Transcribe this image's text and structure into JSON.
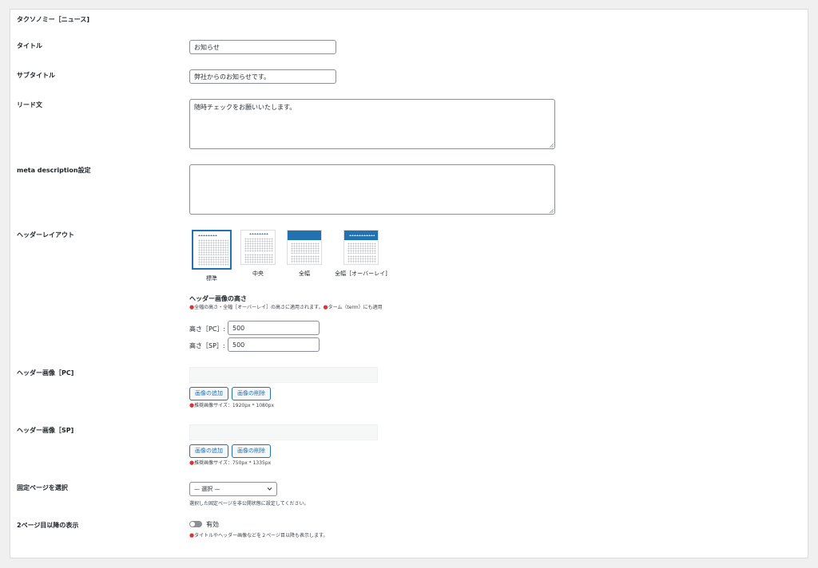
{
  "section_title": "タクソノミー［ニュース]",
  "fields": {
    "title": {
      "label": "タイトル",
      "value": "お知らせ"
    },
    "subtitle": {
      "label": "サブタイトル",
      "value": "弊社からのお知らせです。"
    },
    "lead": {
      "label": "リード文",
      "value": "随時チェックをお願いいたします。"
    },
    "meta": {
      "label": "meta description設定",
      "value": ""
    }
  },
  "header_layout": {
    "label": "ヘッダーレイアウト",
    "options": [
      {
        "caption": "標準",
        "selected": true
      },
      {
        "caption": "中央",
        "selected": false
      },
      {
        "caption": "全幅",
        "selected": false
      },
      {
        "caption": "全幅［オーバーレイ]",
        "selected": false
      }
    ]
  },
  "header_height": {
    "heading": "ヘッダー画像の高さ",
    "note1": "全幅の高さ・全幅［オーバーレイ］の高さに適用されます。",
    "note2": "ターム（term）にも適用",
    "pc_label": "高さ［PC］:",
    "pc_value": "500",
    "sp_label": "高さ［SP］:",
    "sp_value": "500"
  },
  "header_image_pc": {
    "label": "ヘッダー画像［PC]",
    "add_label": "画像の追加",
    "remove_label": "画像の削除",
    "note": "推奨画像サイズ：1920px * 1080px"
  },
  "header_image_sp": {
    "label": "ヘッダー画像［SP]",
    "add_label": "画像の追加",
    "remove_label": "画像の削除",
    "note": "推奨画像サイズ：750px * 1335px"
  },
  "fixed_page": {
    "label": "固定ページを選択",
    "selected": "— 選択 —",
    "note": "選択した固定ページを非公開状態に設定してください。"
  },
  "second_page": {
    "label": "2ページ目以降の表示",
    "toggle_label": "有効",
    "note": "タイトルやヘッダー画像などを２ページ目以降も表示します。"
  },
  "colors": {
    "accent": "#2271b1",
    "required_mark": "#d63638"
  }
}
